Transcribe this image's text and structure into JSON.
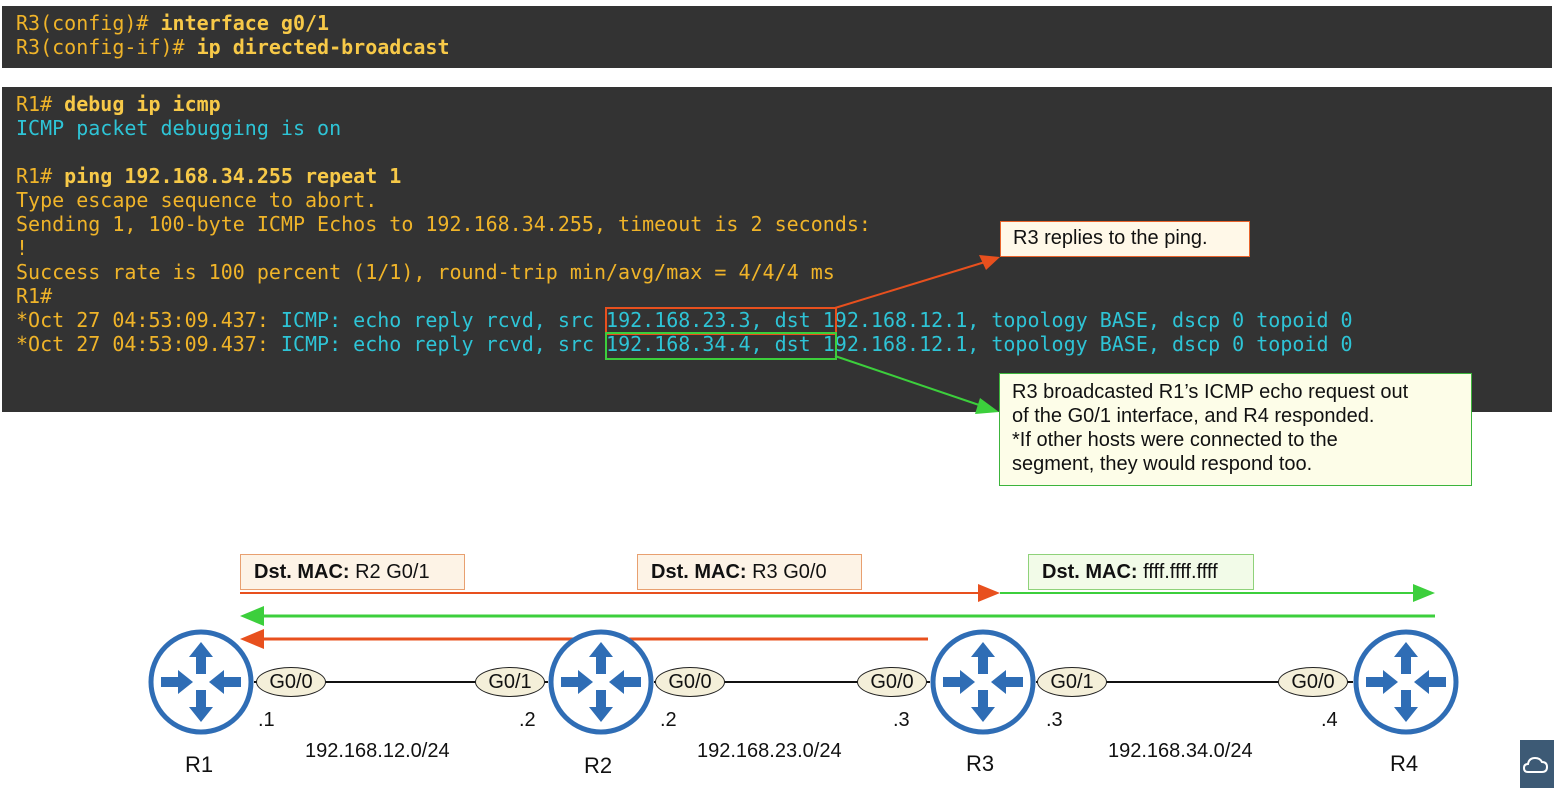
{
  "terminal_top": {
    "lines": [
      {
        "prompt": "R3(config)# ",
        "cmd": "interface g0/1"
      },
      {
        "prompt": "R3(config-if)# ",
        "cmd": "ip directed-broadcast"
      }
    ]
  },
  "terminal_main": {
    "debug_prompt": "R1# ",
    "debug_cmd": "debug ip icmp",
    "debug_status": "ICMP packet debugging is on",
    "ping_prompt": "R1# ",
    "ping_cmd": "ping 192.168.34.255 repeat 1",
    "escape_line": "Type escape sequence to abort.",
    "sending_line": "Sending 1, 100-byte ICMP Echos to 192.168.34.255, timeout is 2 seconds:",
    "bang_line": "!",
    "success_line": "Success rate is 100 percent (1/1), round-trip min/avg/max = 4/4/4 ms",
    "prompt_line": "R1#",
    "replies": [
      {
        "prefix": "*Oct 27 04:53:09.437: ",
        "middle": "ICMP: echo reply rcvd, ",
        "src": "src 192.168.23.3",
        "rest": ", dst 192.168.12.1, topology BASE, dscp 0 topoid 0"
      },
      {
        "prefix": "*Oct 27 04:53:09.437: ",
        "middle": "ICMP: echo reply rcvd, ",
        "src": "src 192.168.34.4",
        "rest": ", dst 192.168.12.1, topology BASE, dscp 0 topoid 0"
      }
    ]
  },
  "callouts": {
    "r3_reply": "R3 replies to the ping.",
    "broadcast_lines": [
      "R3 broadcasted R1’s ICMP echo request out",
      "of the G0/1 interface, and R4 responded.",
      "*If other hosts were connected to the",
      "segment, they would respond too."
    ]
  },
  "mac_labels": [
    {
      "key": "Dst. MAC:",
      "value": " R2 G0/1"
    },
    {
      "key": "Dst. MAC:",
      "value": " R3 G0/0"
    },
    {
      "key": "Dst. MAC:",
      "value": " ffff.ffff.ffff"
    }
  ],
  "routers": [
    "R1",
    "R2",
    "R3",
    "R4"
  ],
  "interfaces": [
    "G0/0",
    "G0/1",
    "G0/0",
    "G0/0",
    "G0/1",
    "G0/0"
  ],
  "host_ids": [
    ".1",
    ".2",
    ".2",
    ".3",
    ".3",
    ".4"
  ],
  "networks": [
    "192.168.12.0/24",
    "192.168.23.0/24",
    "192.168.34.0/24"
  ],
  "colors": {
    "terminal_bg": "#333333",
    "prompt_yellow": "#f0b429",
    "debug_cyan": "#2ec4d6",
    "orange": "#e8501e",
    "green": "#3ccf3c",
    "router_blue": "#2f6db5"
  },
  "icons": {
    "router": "router-icon",
    "corner": "cloud-logo-icon"
  }
}
